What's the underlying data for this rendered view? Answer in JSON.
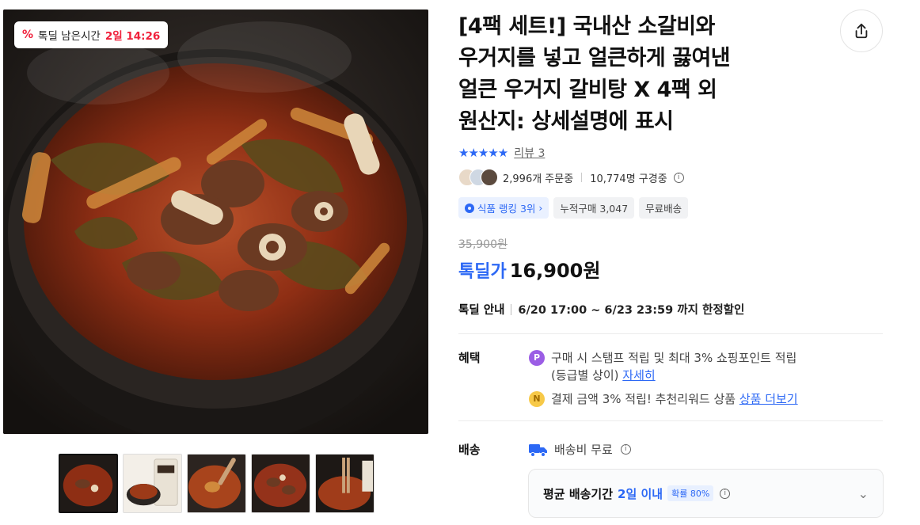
{
  "deal_badge": {
    "icon": "percent-icon",
    "label": "톡딜 남은시간",
    "time": "2일 14:26"
  },
  "product": {
    "title_lines": [
      "[4팩 세트!] 국내산 소갈비와",
      "우거지를 넣고 얼큰하게 끓여낸",
      "얼큰 우거지 갈비탕 X 4팩 외",
      "원산지: 상세설명에 표시"
    ],
    "rating": {
      "stars": "★★★★★",
      "review_label": "리뷰 3"
    },
    "social": {
      "orders": "2,996개 주문중",
      "viewers": "10,774명 구경중"
    },
    "tags": [
      "식품 랭킹 3위",
      "누적구매 3,047",
      "무료배송"
    ],
    "original_price": "35,900원",
    "price_label": "톡딜가",
    "price": "16,900원",
    "deal_info": {
      "label": "톡딜 안내",
      "period": "6/20 17:00 ~ 6/23 23:59 까지 한정할인"
    },
    "benefits": {
      "label": "혜택",
      "item1_line1": "구매 시 스탬프 적립 및 최대 3% 쇼핑포인트 적립",
      "item1_line2": "(등급별 상이)",
      "item1_link": "자세히",
      "item2_text": "결제 금액 3% 적립! 추천리워드 상품",
      "item2_link": "상품 더보기"
    },
    "shipping": {
      "label": "배송",
      "fee": "배송비 무료",
      "avg_label": "평균 배송기간",
      "avg_days": "2일 이내",
      "prob": "확률 80%"
    }
  },
  "colors": {
    "accent": "#2c68f5",
    "deal_red": "#f0203b"
  }
}
